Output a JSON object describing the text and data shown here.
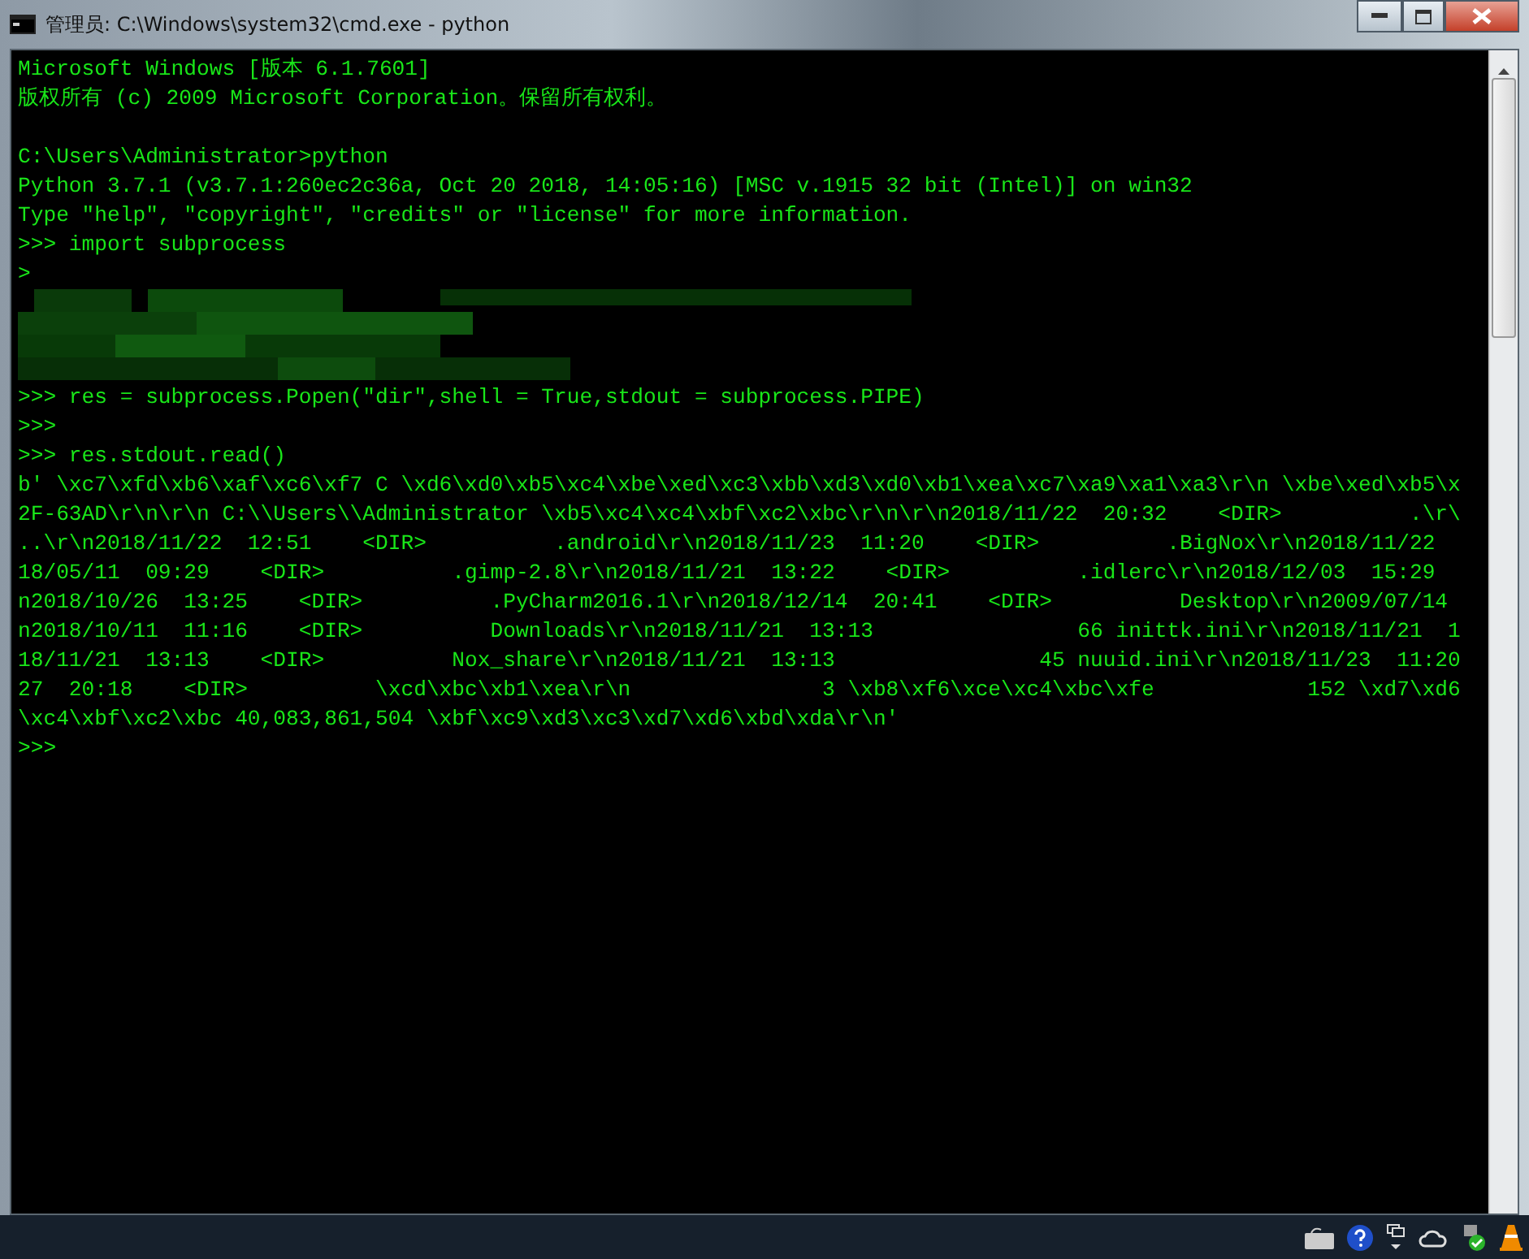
{
  "window": {
    "title": "管理员: C:\\Windows\\system32\\cmd.exe - python"
  },
  "console": {
    "lines": [
      {
        "kind": "text",
        "text": "Microsoft Windows [版本 6.1.7601]"
      },
      {
        "kind": "text",
        "text": "版权所有 (c) 2009 Microsoft Corporation。保留所有权利。"
      },
      {
        "kind": "blank"
      },
      {
        "kind": "text",
        "text": "C:\\Users\\Administrator>python"
      },
      {
        "kind": "text",
        "text": "Python 3.7.1 (v3.7.1:260ec2c36a, Oct 20 2018, 14:05:16) [MSC v.1915 32 bit (Intel)] on win32"
      },
      {
        "kind": "text",
        "text": "Type \"help\", \"copyright\", \"credits\" or \"license\" for more information."
      },
      {
        "kind": "text",
        "text": ">>> import subprocess"
      },
      {
        "kind": "text",
        "text": ">"
      },
      {
        "kind": "redacted"
      },
      {
        "kind": "text",
        "text": ">>> res = subprocess.Popen(\"dir\",shell = True,stdout = subprocess.PIPE)"
      },
      {
        "kind": "text",
        "text": ">>>"
      },
      {
        "kind": "text",
        "text": ">>> res.stdout.read()"
      },
      {
        "kind": "text",
        "text": "b' \\xc7\\xfd\\xb6\\xaf\\xc6\\xf7 C \\xd6\\xd0\\xb5\\xc4\\xbe\\xed\\xc3\\xbb\\xd3\\xd0\\xb1\\xea\\xc7\\xa9\\xa1\\xa3\\r\\n \\xbe\\xed\\xb5\\x"
      },
      {
        "kind": "text",
        "text": "2F-63AD\\r\\n\\r\\n C:\\\\Users\\\\Administrator \\xb5\\xc4\\xc4\\xbf\\xc2\\xbc\\r\\n\\r\\n2018/11/22  20:32    <DIR>          .\\r\\"
      },
      {
        "kind": "text",
        "text": "..\\r\\n2018/11/22  12:51    <DIR>          .android\\r\\n2018/11/23  11:20    <DIR>          .BigNox\\r\\n2018/11/22"
      },
      {
        "kind": "text",
        "text": "18/05/11  09:29    <DIR>          .gimp-2.8\\r\\n2018/11/21  13:22    <DIR>          .idlerc\\r\\n2018/12/03  15:29"
      },
      {
        "kind": "text",
        "text": "n2018/10/26  13:25    <DIR>          .PyCharm2016.1\\r\\n2018/12/14  20:41    <DIR>          Desktop\\r\\n2009/07/14"
      },
      {
        "kind": "text",
        "text": "n2018/10/11  11:16    <DIR>          Downloads\\r\\n2018/11/21  13:13                66 inittk.ini\\r\\n2018/11/21  1"
      },
      {
        "kind": "text",
        "text": "18/11/21  13:13    <DIR>          Nox_share\\r\\n2018/11/21  13:13                45 nuuid.ini\\r\\n2018/11/23  11:20"
      },
      {
        "kind": "text",
        "text": "27  20:18    <DIR>          \\xcd\\xbc\\xb1\\xea\\r\\n               3 \\xb8\\xf6\\xce\\xc4\\xbc\\xfe            152 \\xd7\\xd6"
      },
      {
        "kind": "text",
        "text": "\\xc4\\xbf\\xc2\\xbc 40,083,861,504 \\xbf\\xc9\\xd3\\xc3\\xd7\\xd6\\xbd\\xda\\r\\n'"
      },
      {
        "kind": "text",
        "text": ">>>"
      }
    ]
  }
}
